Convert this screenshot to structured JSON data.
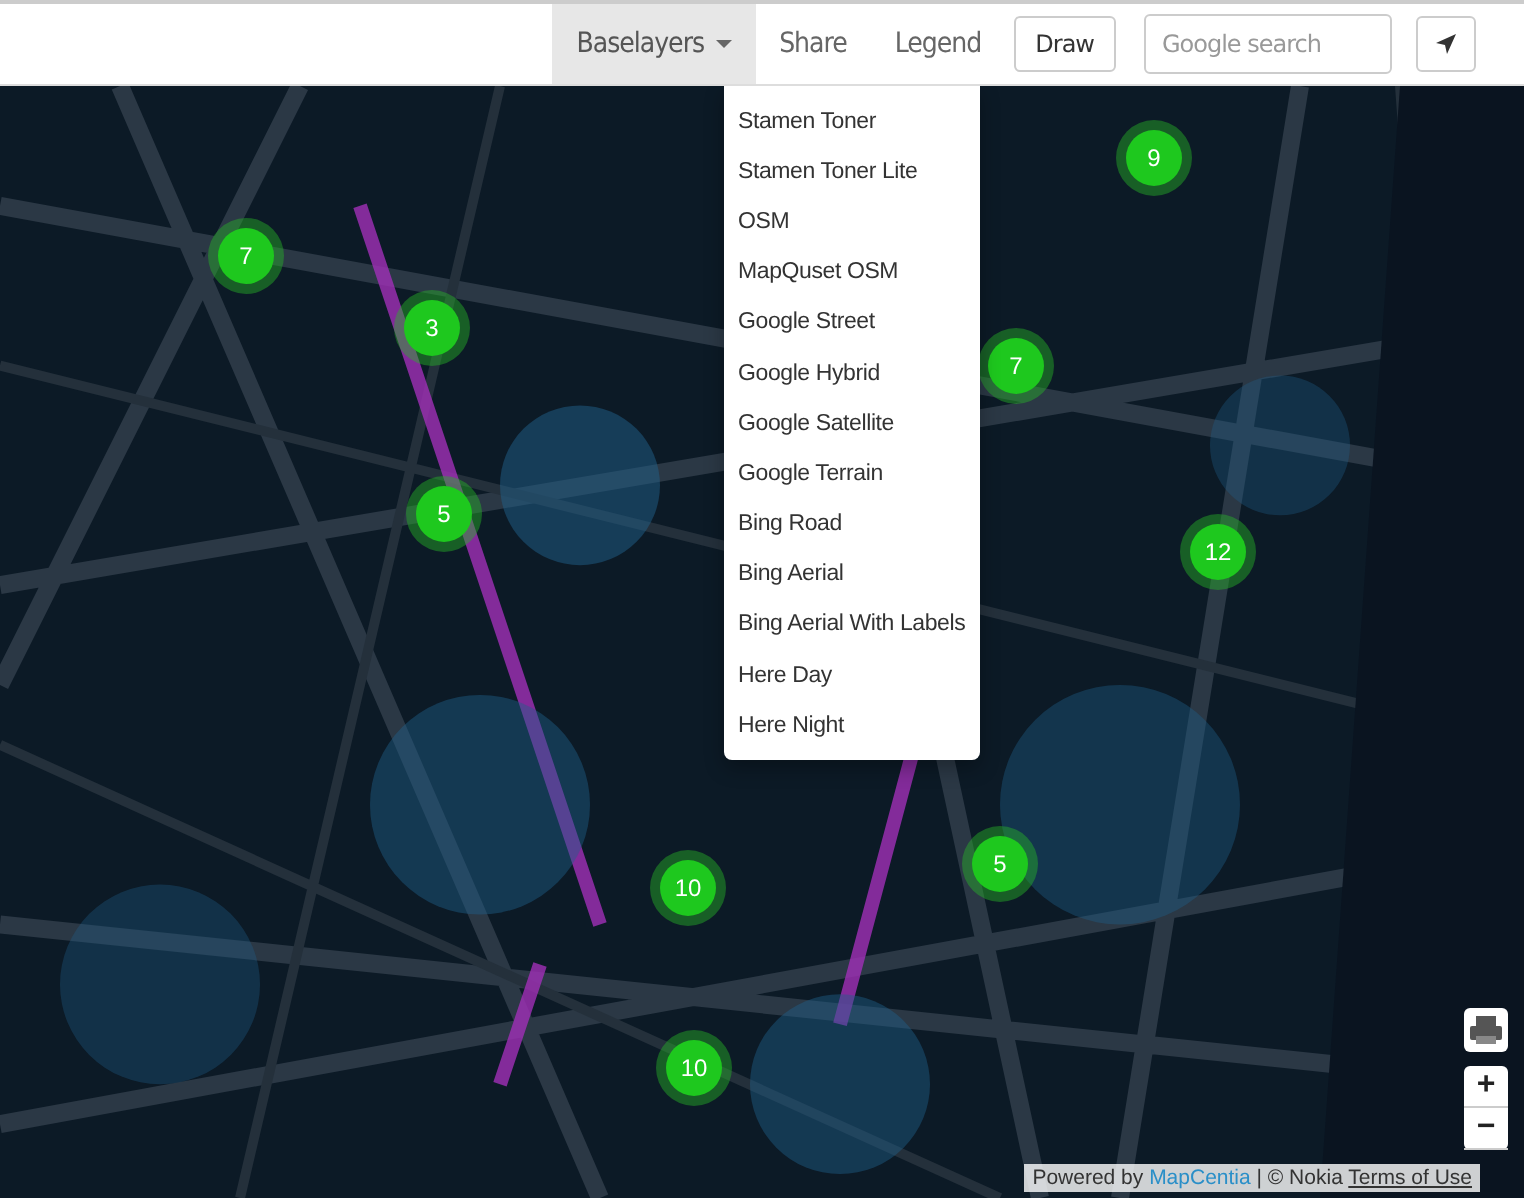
{
  "navbar": {
    "baselayers": {
      "label": "Baselayers",
      "expanded": true
    },
    "share": "Share",
    "legend": "Legend",
    "draw": "Draw",
    "search": {
      "placeholder": "Google search"
    }
  },
  "baselayers_menu": [
    {
      "label": "Stamen Toner"
    },
    {
      "label": "Stamen Toner Lite"
    },
    {
      "label": "OSM"
    },
    {
      "label": "MapQuset OSM"
    },
    {
      "label": "Google Street"
    },
    {
      "label": "Google Hybrid"
    },
    {
      "label": "Google Satellite"
    },
    {
      "label": "Google Terrain"
    },
    {
      "label": "Bing Road"
    },
    {
      "label": "Bing Aerial"
    },
    {
      "label": "Bing Aerial With Labels"
    },
    {
      "label": "Here Day"
    },
    {
      "label": "Here Night"
    }
  ],
  "map": {
    "kind": "picture",
    "clusters": [
      "9",
      "7",
      "3",
      "7",
      "5",
      "12",
      "5",
      "10",
      "10"
    ],
    "zoom_in": "+",
    "zoom_out": "−"
  },
  "attribution": {
    "prefix": "Powered by",
    "link": "MapCentia",
    "middle": "| © Nokia",
    "terms": "Terms of Use"
  }
}
